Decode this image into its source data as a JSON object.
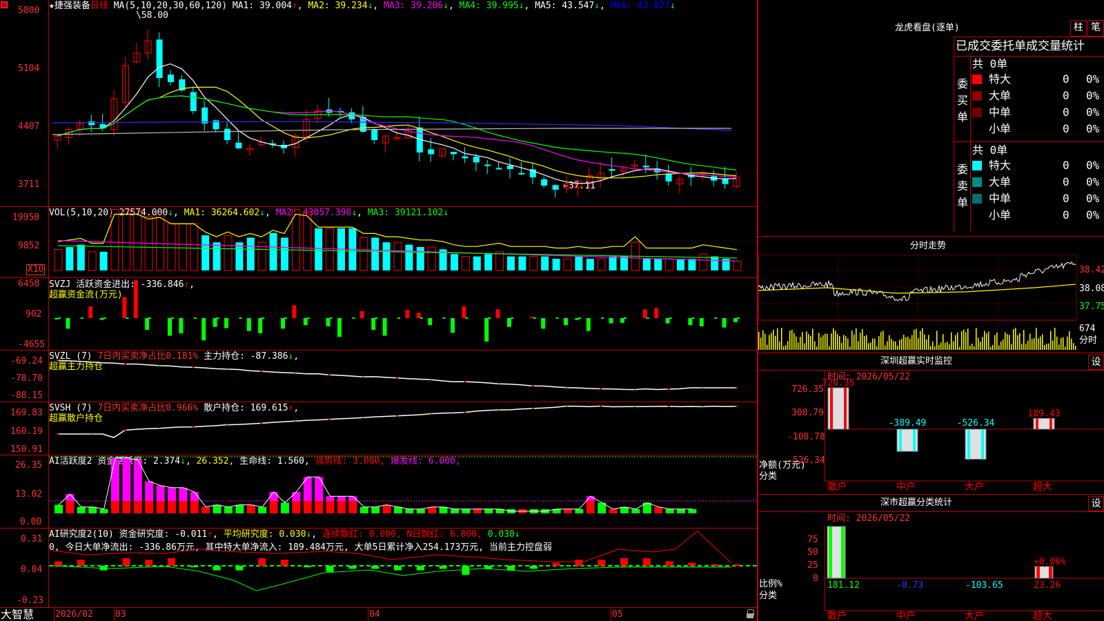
{
  "app": {
    "logo": "大智慧"
  },
  "kline": {
    "star": "★",
    "stock_name": "捷强装备",
    "period": "日线",
    "ma_params": "MA(5,10,20,30,60,120)",
    "ma1": "MA1: 39.004",
    "ma2": "MA2: 39.234",
    "ma3": "MA3: 39.206",
    "ma4": "MA4: 39.995",
    "ma5": "MA5: 43.547",
    "ma6": "MA6: 43.027",
    "high_mark": "58.00",
    "low_mark": "←37.11",
    "y_ticks": [
      "5800",
      "5104",
      "4407",
      "3711"
    ]
  },
  "volume": {
    "title": "VOL(5,10,20)",
    "value": "27574.000",
    "ma1": "MA1: 36264.602",
    "ma2": "MA2: 43057.398",
    "ma3": "MA3: 39121.102",
    "y_ticks": [
      "19950",
      "9852"
    ],
    "unit_label": "X10"
  },
  "svzj": {
    "title": "SVZJ",
    "line": "活跃资金进出: -336.846",
    "subtitle": "超赢资金流(万元)",
    "y_ticks": [
      "6458",
      "902",
      "-4655"
    ]
  },
  "svzl": {
    "title": "SVZL (7)",
    "ratio": "7日内买卖净占比0.181%",
    "line": "主力持仓: -87.386",
    "subtitle": "超赢主力持仓",
    "y_ticks": [
      "-69.24",
      "-78.70",
      "-88.15"
    ]
  },
  "svsh": {
    "title": "SVSH (7)",
    "ratio": "7日内买卖净占比0.966%",
    "line": "散户持仓: 169.615",
    "subtitle": "超赢散户持仓",
    "y_ticks": [
      "169.83",
      "160.19",
      "150.91"
    ]
  },
  "ai1": {
    "title": "AI活跃度2",
    "v1": "资金活跃度: 2.374",
    "v2": "26.352,",
    "v3": "生命线: 1.560,",
    "v4": "强势线: 3.000,",
    "v5": "爆发线: 6.000,",
    "y_ticks": [
      "26.35",
      "13.02",
      "0.00"
    ]
  },
  "ai2": {
    "title": "AI研究度2(10)",
    "v1": "资金研究度: -0.011",
    "v2": "平均研究度: 0.030",
    "v3": "连续飘红: 0.000,",
    "v4": "N日飘红: 6.000,",
    "v5": "0.030",
    "summary": "0, 今日大单净流出: -336.86万元, 其中特大单净流入: 189.484万元, 大单5日累计净入254.173万元, 当前主力控盘弱",
    "y_ticks": [
      "0.31",
      "0.04",
      "-0.23"
    ]
  },
  "xaxis": {
    "labels": [
      "2026/02",
      "03",
      "04",
      "05"
    ]
  },
  "dragon": {
    "title": "龙虎看盘(逐单)",
    "btn_bar": "柱",
    "btn_pen": "笔",
    "header": "已成交委托单成交量统计",
    "buy_label": "委买单",
    "sell_label": "委卖单",
    "buy_total": "共 0单",
    "sell_total": "共 0单",
    "buy_rows": [
      {
        "name": "特大",
        "count": "0",
        "pct": "0%",
        "color": "#ff0000"
      },
      {
        "name": "大单",
        "count": "0",
        "pct": "0%",
        "color": "#8b0000"
      },
      {
        "name": "中单",
        "count": "0",
        "pct": "0%",
        "color": "#6b0000"
      },
      {
        "name": "小单",
        "count": "0",
        "pct": "0%",
        "color": ""
      }
    ],
    "sell_rows": [
      {
        "name": "特大",
        "count": "0",
        "pct": "0%",
        "color": "#00ffff"
      },
      {
        "name": "大单",
        "count": "0",
        "pct": "0%",
        "color": "#008b8b"
      },
      {
        "name": "中单",
        "count": "0",
        "pct": "0%",
        "color": "#007070"
      },
      {
        "name": "小单",
        "count": "0",
        "pct": "0%",
        "color": ""
      }
    ]
  },
  "intraday": {
    "title": "分时走势",
    "prices": [
      "38.42",
      "38.08",
      "37.75"
    ],
    "volume": "674",
    "volume_label": "分时"
  },
  "monitor": {
    "title": "深圳超赢实时监控",
    "settings": "设",
    "time": "时间: 2026/05/22",
    "y_ticks": [
      "726.35",
      "308.79",
      "-108.78",
      "-526.34"
    ],
    "unit": "净额(万元)",
    "cat_label": "分类",
    "categories": [
      "散户",
      "中户",
      "大户",
      "超大"
    ],
    "values": [
      "726.35",
      "-389.49",
      "-526.34",
      "189.43"
    ]
  },
  "classify": {
    "title": "深市超赢分类统计",
    "settings": "设",
    "time": "时间: 2026/05/22",
    "y_ticks": [
      "75",
      "50",
      "25",
      "0"
    ],
    "ratio_label": "比例%",
    "cat_label": "分类",
    "categories": [
      "散户",
      "中户",
      "大户",
      "超大"
    ],
    "values": [
      "181.12",
      "-0.73",
      "-103.65",
      "23.26"
    ],
    "pct_label": "+0.06%"
  },
  "colors": {
    "up": "#ff0000",
    "down": "#00ffff",
    "grid": "#c00000",
    "green": "#00ff00",
    "magenta": "#ff00ff",
    "yellow": "#ffff00"
  },
  "chart_data": {
    "type": "candlestick",
    "series": [
      {
        "name": "资金活跃度",
        "values": [
          4,
          9,
          3,
          3,
          2,
          26,
          26,
          25,
          15,
          13,
          12,
          12,
          10,
          3,
          4,
          3,
          4,
          4,
          3,
          10,
          5,
          10,
          17,
          17,
          8,
          8,
          8,
          3,
          3,
          4,
          3,
          2,
          2,
          3,
          3,
          2,
          2,
          2,
          2,
          2,
          1,
          1,
          1,
          1,
          2,
          2,
          2,
          8,
          5,
          2,
          3,
          2,
          5,
          3,
          2,
          2,
          2
        ]
      },
      {
        "name": "超赢资金流",
        "values": [
          -200,
          -1800,
          2000,
          -300,
          3600,
          6458,
          -2000,
          -3000,
          -2600,
          -3800,
          -1500,
          -1700,
          -2200,
          -2600,
          -1800,
          2200,
          -1200,
          -1400,
          -3200,
          1200,
          -2000,
          -3000,
          1400,
          900,
          -1200,
          -2500,
          2000,
          -4000,
          1500,
          -1500,
          200,
          -1800,
          -1200,
          -300,
          -2200,
          -900,
          -800,
          1500,
          1700,
          -900,
          -1200,
          -1400,
          -1600,
          -700
        ]
      }
    ]
  }
}
